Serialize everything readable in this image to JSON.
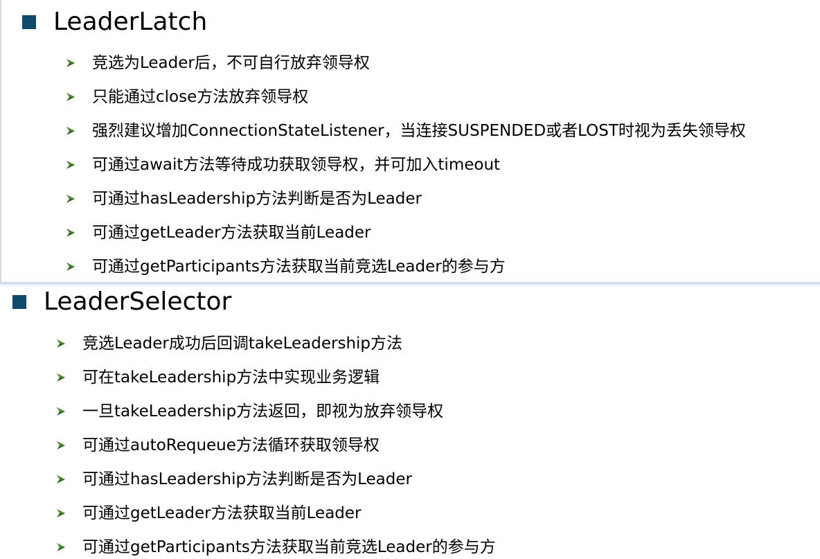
{
  "sections": [
    {
      "title": "LeaderLatch",
      "items": [
        "竞选为Leader后，不可自行放弃领导权",
        "只能通过close方法放弃领导权",
        "强烈建议增加ConnectionStateListener，当连接SUSPENDED或者LOST时视为丢失领导权",
        "可通过await方法等待成功获取领导权，并可加入timeout",
        "可通过hasLeadership方法判断是否为Leader",
        "可通过getLeader方法获取当前Leader",
        "可通过getParticipants方法获取当前竞选Leader的参与方"
      ]
    },
    {
      "title": "LeaderSelector",
      "items": [
        "竞选Leader成功后回调takeLeadership方法",
        "可在takeLeadership方法中实现业务逻辑",
        "一旦takeLeadership方法返回，即视为放弃领导权",
        "可通过autoRequeue方法循环获取领导权",
        "可通过hasLeadership方法判断是否为Leader",
        "可通过getLeader方法获取当前Leader",
        "可通过getParticipants方法获取当前竞选Leader的参与方"
      ]
    }
  ],
  "colors": {
    "square_bullet": "#0d4a6b",
    "arrow_bullet": "#1b5e20",
    "text": "#000000"
  },
  "icons": {
    "section_bullet": "square-bullet-icon",
    "item_bullet": "arrow-bullet-icon"
  }
}
